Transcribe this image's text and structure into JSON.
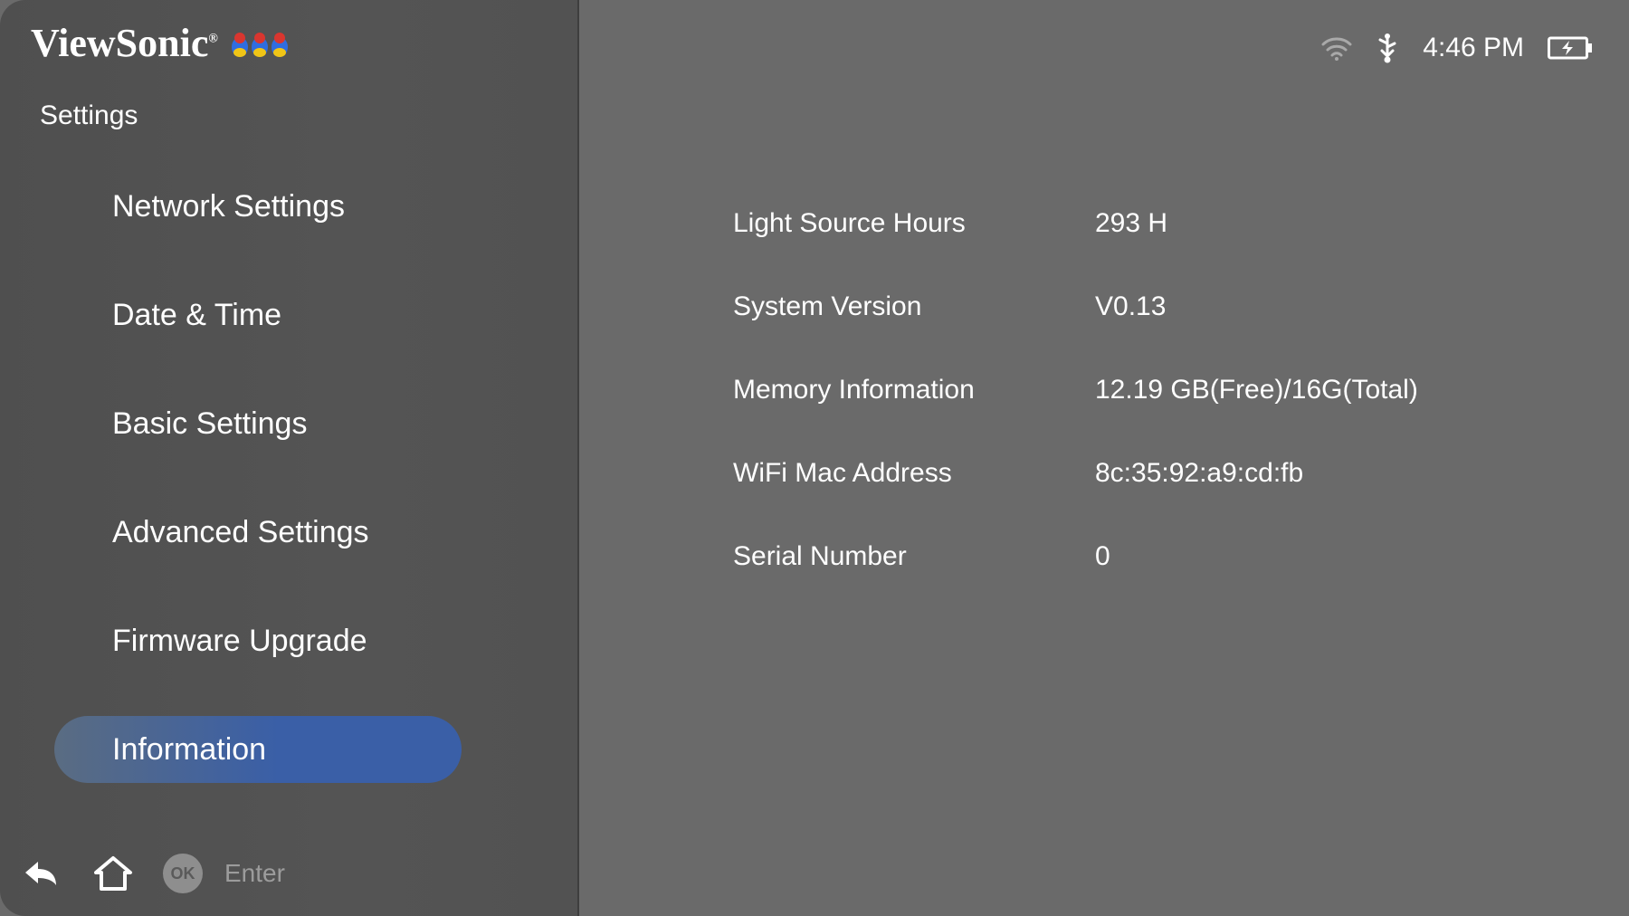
{
  "brand": "ViewSonic",
  "section_title": "Settings",
  "menu": [
    {
      "label": "Network Settings"
    },
    {
      "label": "Date & Time"
    },
    {
      "label": "Basic Settings"
    },
    {
      "label": "Advanced Settings"
    },
    {
      "label": "Firmware Upgrade"
    },
    {
      "label": "Information",
      "selected": true
    }
  ],
  "bottom": {
    "enter": "Enter",
    "ok": "OK"
  },
  "status": {
    "time": "4:46 PM"
  },
  "info": [
    {
      "label": "Light Source Hours",
      "value": "293 H"
    },
    {
      "label": "System Version",
      "value": "V0.13"
    },
    {
      "label": "Memory Information",
      "value": "12.19 GB(Free)/16G(Total)"
    },
    {
      "label": "WiFi Mac Address",
      "value": "8c:35:92:a9:cd:fb"
    },
    {
      "label": "Serial Number",
      "value": "0"
    }
  ]
}
